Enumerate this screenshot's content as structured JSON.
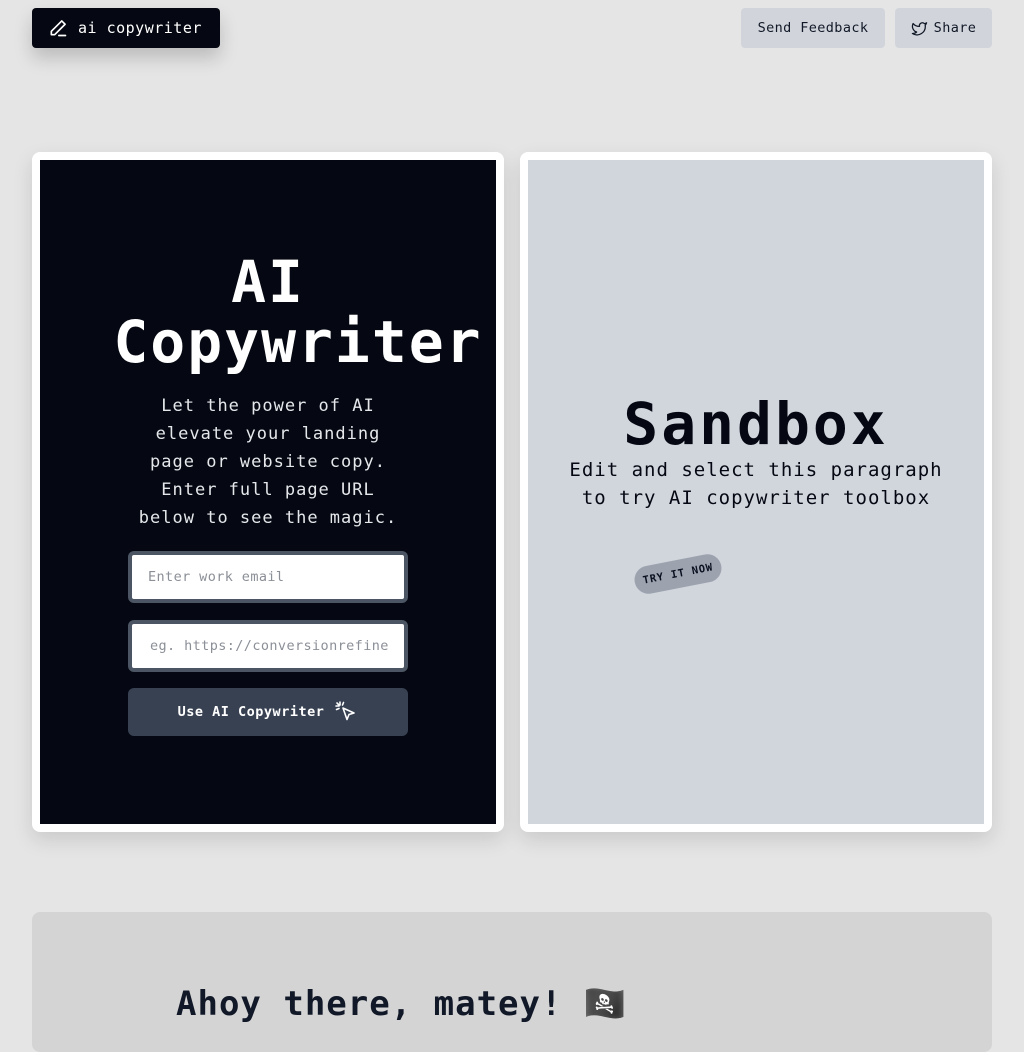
{
  "header": {
    "brand_label": "ai copywriter",
    "feedback_label": "Send Feedback",
    "share_label": "Share"
  },
  "hero": {
    "title_line1": "AI",
    "title_line2": "Copywriter",
    "subtitle": "Let the power of AI elevate your landing page or website copy. Enter full page URL below to see the magic.",
    "email_placeholder": "Enter work email",
    "url_placeholder": "eg. https://conversionrefiner.com",
    "cta_label": "Use AI Copywriter"
  },
  "sandbox": {
    "title": "Sandbox",
    "text": "Edit and select this paragraph to try AI copywriter toolbox",
    "badge": "TRY IT NOW"
  },
  "section": {
    "heading": "Ahoy there, matey! 🏴‍☠️"
  },
  "icons": {
    "brand": "pencil-icon",
    "share": "twitter-bird-icon",
    "cta": "sparkle-cursor-icon"
  },
  "colors": {
    "page_bg": "#e5e5e5",
    "dark_panel": "#050812",
    "light_panel": "#d1d5dc",
    "button_gray": "#d1d5db",
    "cta_bg": "#374151"
  }
}
